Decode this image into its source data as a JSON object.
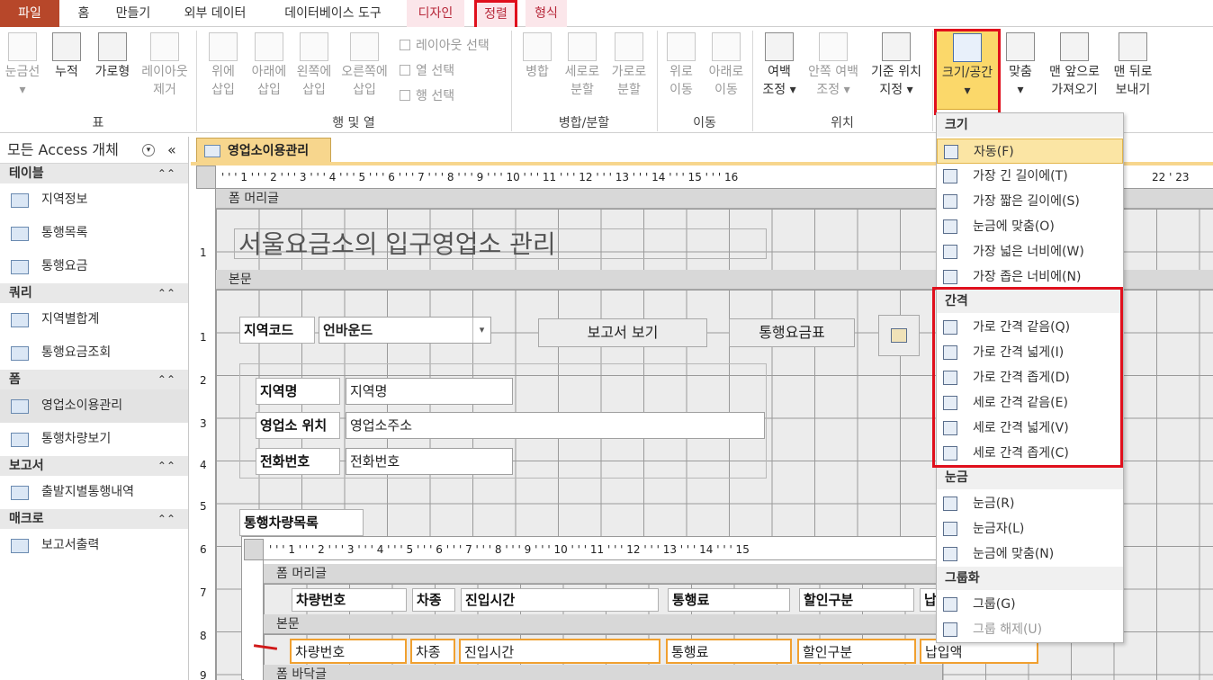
{
  "tabs": [
    "파일",
    "홈",
    "만들기",
    "외부 데이터",
    "데이터베이스 도구",
    "디자인",
    "정렬",
    "형식"
  ],
  "ribbon": {
    "buttons": [
      {
        "label": "눈금선",
        "label2": "▾"
      },
      {
        "label": "누적",
        "label2": ""
      },
      {
        "label": "가로형",
        "label2": ""
      },
      {
        "label": "레이아웃",
        "label2": "제거"
      },
      {
        "label": "위에",
        "label2": "삽입"
      },
      {
        "label": "아래에",
        "label2": "삽입"
      },
      {
        "label": "왼쪽에",
        "label2": "삽입"
      },
      {
        "label": "오른쪽에",
        "label2": "삽입"
      },
      {
        "label": "병합",
        "label2": ""
      },
      {
        "label": "세로로",
        "label2": "분할"
      },
      {
        "label": "가로로",
        "label2": "분할"
      },
      {
        "label": "위로",
        "label2": "이동"
      },
      {
        "label": "아래로",
        "label2": "이동"
      },
      {
        "label": "여백",
        "label2": "조정 ▾"
      },
      {
        "label": "안쪽 여백",
        "label2": "조정 ▾"
      },
      {
        "label": "기준 위치",
        "label2": "지정 ▾"
      },
      {
        "label": "크기/공간",
        "label2": "▾"
      },
      {
        "label": "맞춤",
        "label2": "▾"
      },
      {
        "label": "맨 앞으로",
        "label2": "가져오기"
      },
      {
        "label": "맨 뒤로",
        "label2": "보내기"
      }
    ],
    "small": [
      "레이아웃 선택",
      "열 선택",
      "행 선택"
    ],
    "groups": [
      "표",
      "행 및 열",
      "병합/분할",
      "이동",
      "위치"
    ]
  },
  "nav": {
    "title": "모든 Access 개체",
    "categories": [
      {
        "name": "테이블",
        "items": [
          "지역정보",
          "통행목록",
          "통행요금"
        ]
      },
      {
        "name": "쿼리",
        "items": [
          "지역별합계",
          "통행요금조회"
        ]
      },
      {
        "name": "폼",
        "items": [
          "영업소이용관리",
          "통행차량보기"
        ]
      },
      {
        "name": "보고서",
        "items": [
          "출발지별통행내역"
        ]
      },
      {
        "name": "매크로",
        "items": [
          "보고서출력"
        ]
      }
    ]
  },
  "doc": {
    "tab": "영업소이용관리",
    "ruler": "' ' ' 1 ' ' ' 2 ' ' ' 3 ' ' ' 4 ' ' ' 5 ' ' ' 6 ' ' ' 7 ' ' ' 8 ' ' ' 9 ' ' ' 10 ' ' ' 11 ' ' ' 12 ' ' ' 13 ' ' ' 14 ' ' ' 15 ' ' ' 16",
    "ruler_right": "22 ' 23",
    "sub_ruler": "' ' ' 1 ' ' ' 2 ' ' ' 3 ' ' ' 4 ' ' ' 5 ' ' ' 6 ' ' ' 7 ' ' ' 8 ' ' ' 9 ' ' ' 10 ' ' ' 11 ' ' ' 12 ' ' ' 13 ' ' ' 14 ' ' ' 15",
    "vruler": [
      "1",
      "1",
      "2",
      "3",
      "4",
      "5",
      "6",
      "7",
      "8",
      "9"
    ],
    "form_header": "폼 머리글",
    "title_text": "서울요금소의 입구영업소 관리",
    "detail": "본문",
    "region_label": "지역코드",
    "region_value": "언바운드",
    "report_btn": "보고서 보기",
    "toll_btn": "통행요금표",
    "name_label": "지역명",
    "name_value": "지역명",
    "addr_label": "영업소 위치",
    "addr_value": "영업소주소",
    "phone_label": "전화번호",
    "phone_value": "전화번호",
    "sub_label": "통행차량목록",
    "sub_header": "폼 머리글",
    "sub_detail": "본문",
    "sub_footer": "폼 바닥글",
    "col_labels": [
      "차량번호",
      "차종",
      "진입시간",
      "통행료",
      "할인구분",
      "납"
    ],
    "col_fields": [
      "차량번호",
      "차종",
      "진입시간",
      "통행료",
      "할인구분",
      "납입액"
    ]
  },
  "menu": {
    "sections": [
      {
        "title": "크기",
        "items": [
          "자동(F)",
          "가장 긴 길이에(T)",
          "가장 짧은 길이에(S)",
          "눈금에 맞춤(O)",
          "가장 넓은 너비에(W)",
          "가장 좁은 너비에(N)"
        ]
      },
      {
        "title": "간격",
        "items": [
          "가로 간격 같음(Q)",
          "가로 간격 넓게(I)",
          "가로 간격 좁게(D)",
          "세로 간격 같음(E)",
          "세로 간격 넓게(V)",
          "세로 간격 좁게(C)"
        ]
      },
      {
        "title": "눈금",
        "items": [
          "눈금(R)",
          "눈금자(L)",
          "눈금에 맞춤(N)"
        ]
      },
      {
        "title": "그룹화",
        "items": [
          "그룹(G)",
          "그룹 해제(U)"
        ]
      }
    ]
  }
}
